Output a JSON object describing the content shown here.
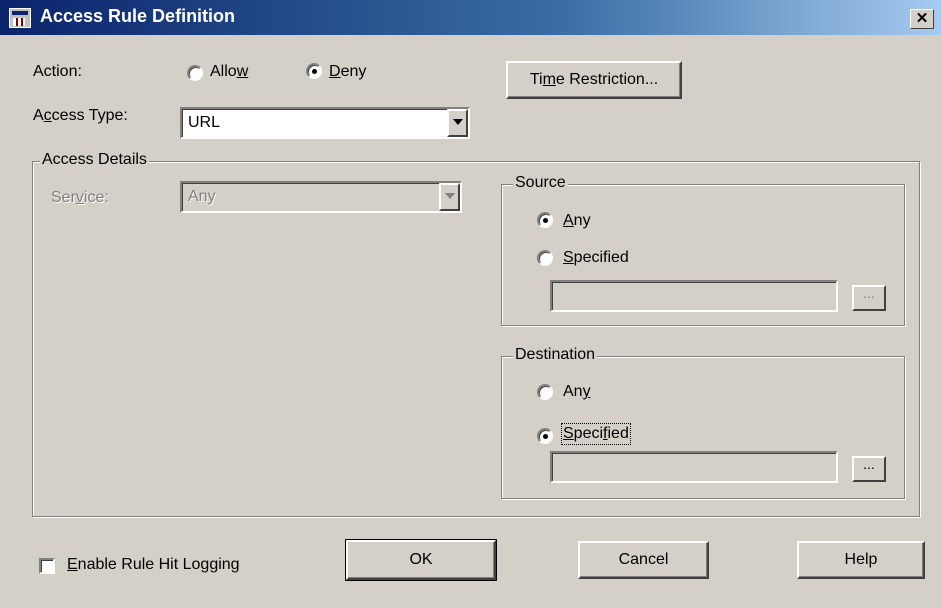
{
  "title": "Access Rule Definition",
  "close_glyph": "✕",
  "action": {
    "label": "Action:",
    "allow": "Allow",
    "deny": "Deny",
    "selected": "Deny"
  },
  "time_restriction_button": "Time Restriction...",
  "access_type": {
    "label": "Access Type:",
    "value": "URL"
  },
  "access_details": {
    "legend": "Access Details",
    "service_label": "Service:",
    "service_value": "Any"
  },
  "source": {
    "legend": "Source",
    "any": "Any",
    "specified": "Specified",
    "selected": "Any",
    "browse": "..."
  },
  "destination": {
    "legend": "Destination",
    "any": "Any",
    "specified": "Specified",
    "selected": "Specified",
    "browse": "..."
  },
  "enable_logging": {
    "label": "Enable Rule Hit Logging",
    "checked": false
  },
  "buttons": {
    "ok": "OK",
    "cancel": "Cancel",
    "help": "Help"
  },
  "colors": {
    "title_start": "#0a246a",
    "title_end": "#a6caf0",
    "face": "#d4d0c8"
  }
}
